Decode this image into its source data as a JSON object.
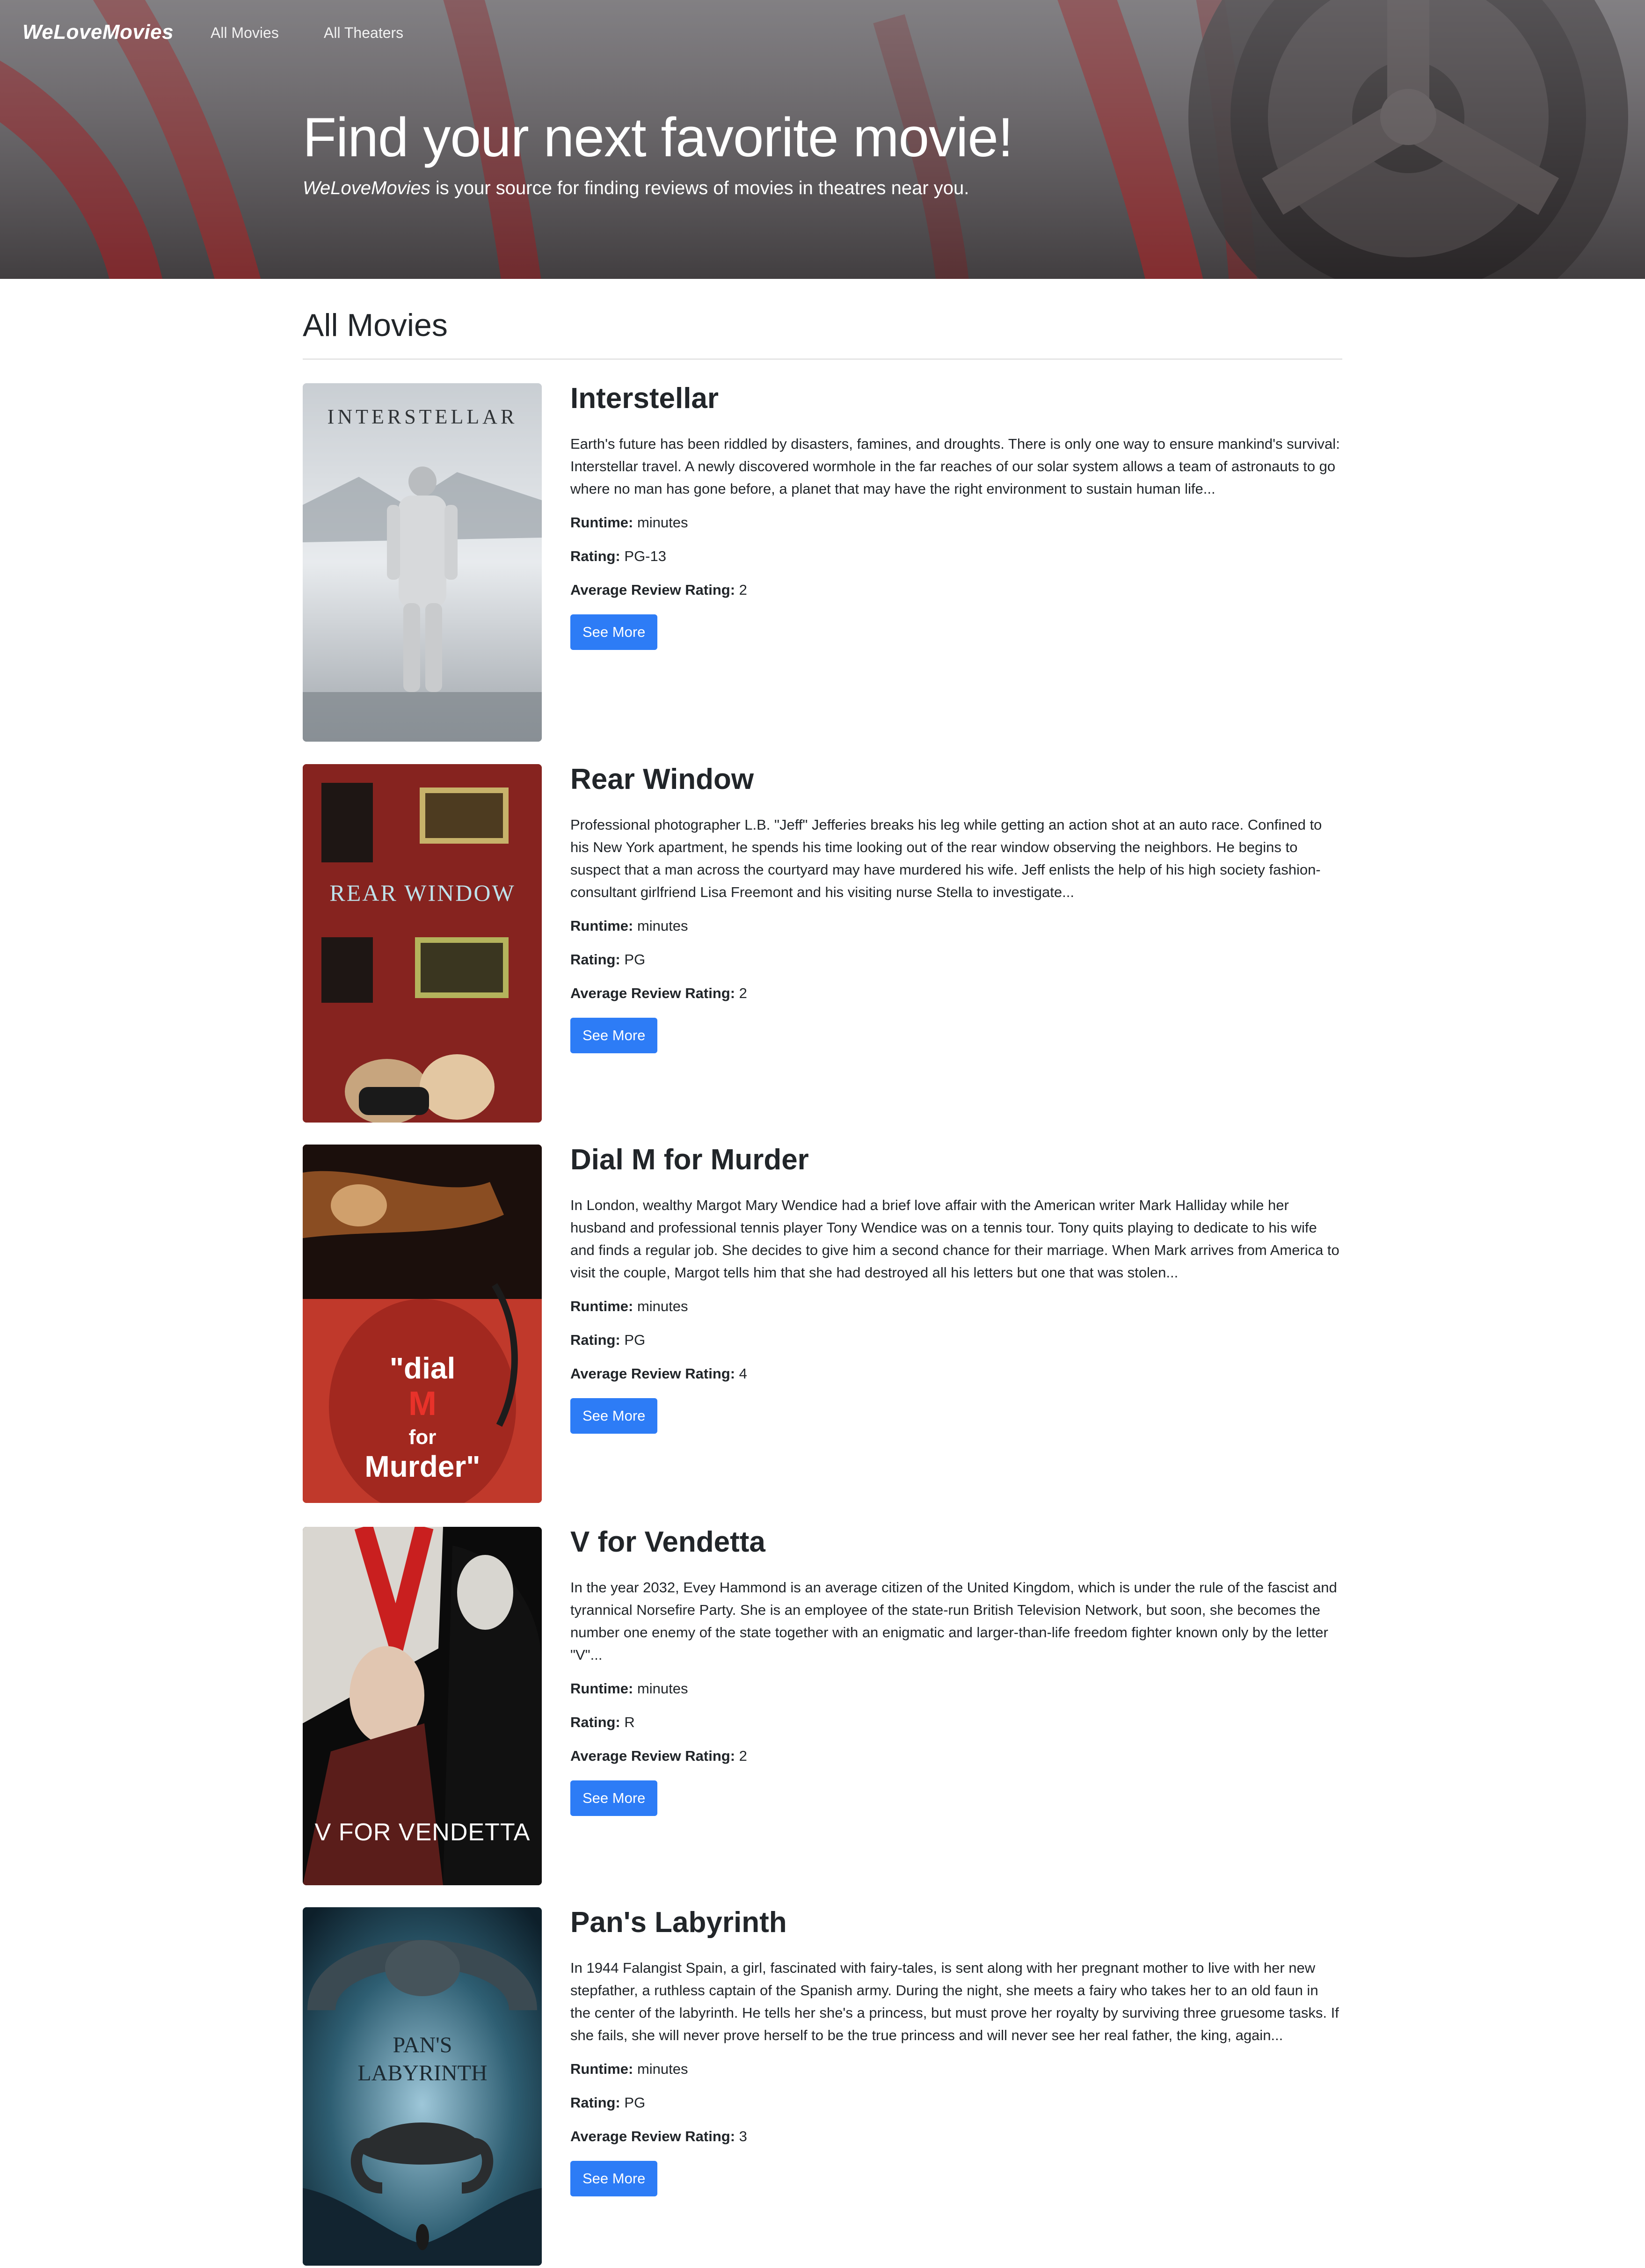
{
  "nav": {
    "brand": "WeLoveMovies",
    "links": [
      {
        "label": "All Movies"
      },
      {
        "label": "All Theaters"
      }
    ]
  },
  "hero": {
    "title": "Find your next favorite movie!",
    "subtitle_em": "WeLoveMovies",
    "subtitle_rest": " is your source for finding reviews of movies in theatres near you."
  },
  "section": {
    "title": "All Movies"
  },
  "labels": {
    "runtime": "Runtime:",
    "rating": "Rating:",
    "average": "Average Review Rating:",
    "see_more": "See More"
  },
  "movies": [
    {
      "title": "Interstellar",
      "poster_text": "INTERSTELLAR",
      "description": "Earth's future has been riddled by disasters, famines, and droughts. There is only one way to ensure mankind's survival: Interstellar travel. A newly discovered wormhole in the far reaches of our solar system allows a team of astronauts to go where no man has gone before, a planet that may have the right environment to sustain human life...",
      "runtime": "minutes",
      "rating": "PG-13",
      "average": "2"
    },
    {
      "title": "Rear Window",
      "poster_text": "REAR WINDOW",
      "description": "Professional photographer L.B. \"Jeff\" Jefferies breaks his leg while getting an action shot at an auto race. Confined to his New York apartment, he spends his time looking out of the rear window observing the neighbors. He begins to suspect that a man across the courtyard may have murdered his wife. Jeff enlists the help of his high society fashion-consultant girlfriend Lisa Freemont and his visiting nurse Stella to investigate...",
      "runtime": "minutes",
      "rating": "PG",
      "average": "2"
    },
    {
      "title": "Dial M for Murder",
      "poster_text": "dial M for Murder",
      "description": "In London, wealthy Margot Mary Wendice had a brief love affair with the American writer Mark Halliday while her husband and professional tennis player Tony Wendice was on a tennis tour. Tony quits playing to dedicate to his wife and finds a regular job. She decides to give him a second chance for their marriage. When Mark arrives from America to visit the couple, Margot tells him that she had destroyed all his letters but one that was stolen...",
      "runtime": "minutes",
      "rating": "PG",
      "average": "4"
    },
    {
      "title": "V for Vendetta",
      "poster_text": "V FOR VENDETTA",
      "description": "In the year 2032, Evey Hammond is an average citizen of the United Kingdom, which is under the rule of the fascist and tyrannical Norsefire Party. She is an employee of the state-run British Television Network, but soon, she becomes the number one enemy of the state together with an enigmatic and larger-than-life freedom fighter known only by the letter \"V\"...",
      "runtime": "minutes",
      "rating": "R",
      "average": "2"
    },
    {
      "title": "Pan's Labyrinth",
      "poster_text": "PAN'S LABYRINTH",
      "description": "In 1944 Falangist Spain, a girl, fascinated with fairy-tales, is sent along with her pregnant mother to live with her new stepfather, a ruthless captain of the Spanish army. During the night, she meets a fairy who takes her to an old faun in the center of the labyrinth. He tells her she's a princess, but must prove her royalty by surviving three gruesome tasks. If she fails, she will never prove herself to be the true princess and will never see her real father, the king, again...",
      "runtime": "minutes",
      "rating": "PG",
      "average": "3"
    }
  ]
}
